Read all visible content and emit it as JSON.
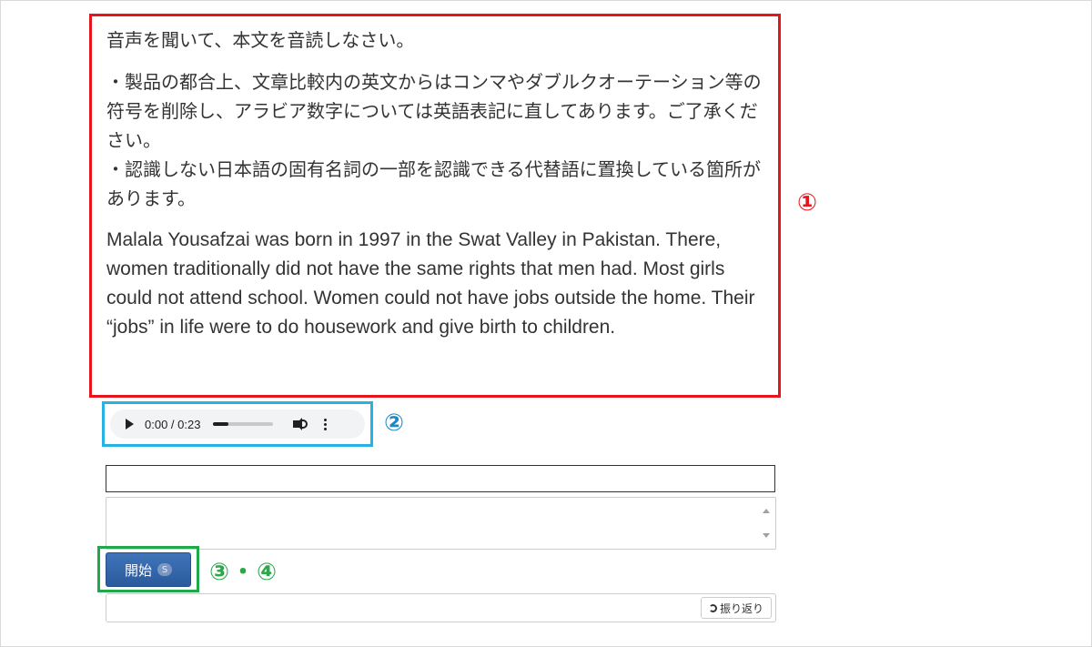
{
  "passage": {
    "instruction": "音声を聞いて、本文を音読しなさい。",
    "note1": "・製品の都合上、文章比較内の英文からはコンマやダブルクオーテーション等の符号を削除し、アラビア数字については英語表記に直してあります。ご了承ください。",
    "note2": "・認識しない日本語の固有名詞の一部を認識できる代替語に置換している箇所があります。",
    "english": "Malala Yousafzai was born in 1997 in the Swat Valley in Pakistan. There, women traditionally did not have the same rights that men had. Most girls could not attend school. Women could not have jobs outside the home. Their “jobs” in life were to do housework and give birth to children."
  },
  "callouts": {
    "one": "①",
    "two": "②",
    "three_four": "③・④"
  },
  "audio": {
    "time": "0:00 / 0:23",
    "progress_fraction": 0.25,
    "icons": [
      "play-icon",
      "volume-icon",
      "more-options-icon"
    ]
  },
  "controls": {
    "start_label": "開始",
    "start_badge": "S",
    "review_label": "振り返り"
  },
  "colors": {
    "callout1": "#e8141c",
    "callout2": "#1e88c9",
    "callout34": "#2aa84a",
    "start_button": "#2b5a9e"
  }
}
